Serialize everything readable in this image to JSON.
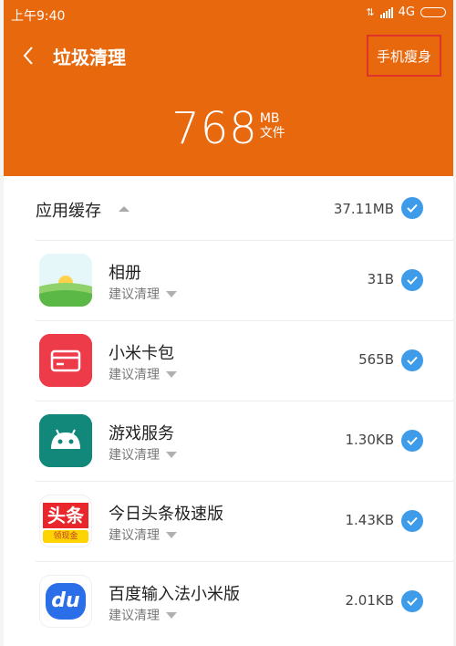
{
  "status_bar": {
    "time": "上午9:40",
    "network": "4G"
  },
  "header": {
    "title": "垃圾清理",
    "slim_button": "手机瘦身",
    "size_value": "768",
    "size_unit": "MB",
    "size_caption": "文件"
  },
  "section": {
    "label": "应用缓存",
    "size": "37.11MB",
    "checked": true
  },
  "apps": [
    {
      "name": "相册",
      "sub": "建议清理",
      "size": "31B",
      "icon": "gallery-icon"
    },
    {
      "name": "小米卡包",
      "sub": "建议清理",
      "size": "565B",
      "icon": "card-wallet-icon"
    },
    {
      "name": "游戏服务",
      "sub": "建议清理",
      "size": "1.30KB",
      "icon": "android-icon"
    },
    {
      "name": "今日头条极速版",
      "sub": "建议清理",
      "size": "1.43KB",
      "icon": "toutiao-icon",
      "icon_text": "头条",
      "icon_badge": "领现金"
    },
    {
      "name": "百度输入法小米版",
      "sub": "建议清理",
      "size": "2.01KB",
      "icon": "baidu-input-icon",
      "icon_text": "du"
    }
  ],
  "colors": {
    "accent": "#e8680e",
    "check": "#3d9be9",
    "highlight_border": "#e0322b"
  }
}
